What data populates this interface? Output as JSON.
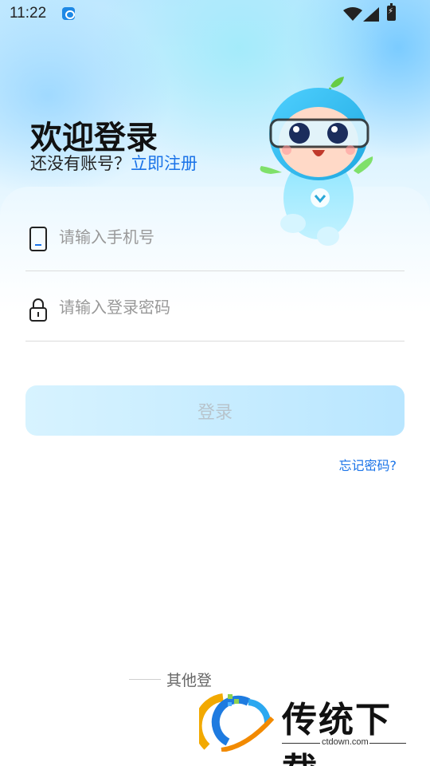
{
  "status_bar": {
    "time": "11:22"
  },
  "header": {
    "title": "欢迎登录",
    "register_prompt": "还没有账号？",
    "register_link": "立即注册"
  },
  "form": {
    "phone_placeholder": "请输入手机号",
    "password_placeholder": "请输入登录密码",
    "login_label": "登录",
    "forgot_label": "忘记密码?"
  },
  "other_login": {
    "label": "其他登录方式"
  },
  "watermark": {
    "title": "传统下载",
    "url": "ctdown.com"
  },
  "colors": {
    "accent": "#1a73e8",
    "button_bg": "#c6ecff",
    "button_text": "#b8c4cc"
  }
}
